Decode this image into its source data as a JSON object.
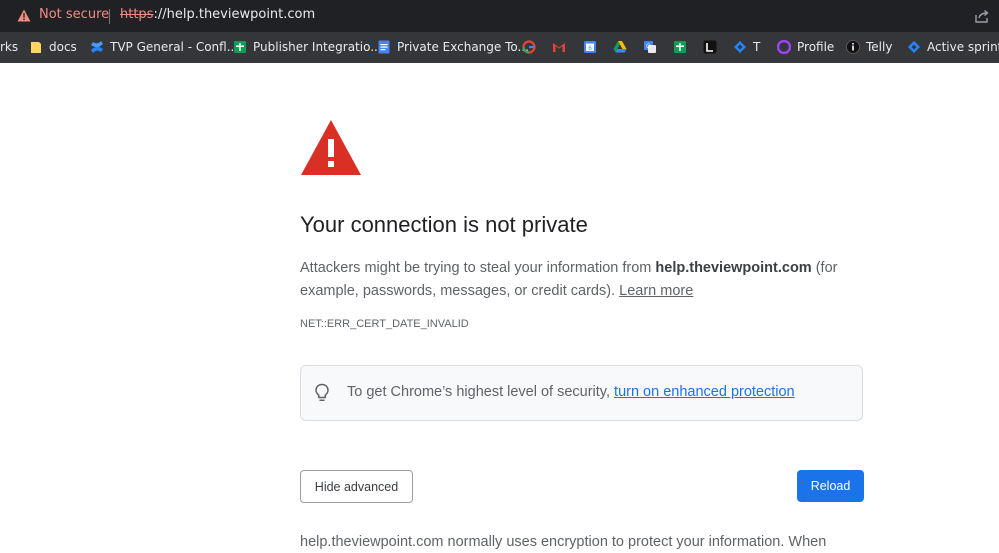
{
  "omnibox": {
    "security_label": "Not secure",
    "url_scheme": "https",
    "url_rest": "://help.theviewpoint.com"
  },
  "bookmarks": [
    {
      "label": "rks",
      "icon": "none"
    },
    {
      "label": "docs",
      "icon": "folder-icon"
    },
    {
      "label": "TVP General - Confl...",
      "icon": "confluence-icon"
    },
    {
      "label": "Publisher Integratio...",
      "icon": "sheets-icon"
    },
    {
      "label": "Private Exchange To...",
      "icon": "docs-icon"
    },
    {
      "label": "",
      "icon": "google-icon"
    },
    {
      "label": "",
      "icon": "gmail-icon"
    },
    {
      "label": "",
      "icon": "calendar-icon"
    },
    {
      "label": "",
      "icon": "drive-icon"
    },
    {
      "label": "",
      "icon": "translate-icon"
    },
    {
      "label": "",
      "icon": "sheets-icon"
    },
    {
      "label": "",
      "icon": "dark-app-icon"
    },
    {
      "label": "T",
      "icon": "jira-icon"
    },
    {
      "label": "Profile",
      "icon": "profile-icon"
    },
    {
      "label": "Telly",
      "icon": "telly-icon"
    },
    {
      "label": "Active sprints",
      "icon": "jira-icon"
    }
  ],
  "page": {
    "heading": "Your connection is not private",
    "para_before": "Attackers might be trying to steal your information from ",
    "para_domain": "help.theviewpoint.com",
    "para_after": " (for example, passwords, messages, or credit cards). ",
    "learn_more": "Learn more",
    "error_code": "NET::ERR_CERT_DATE_INVALID",
    "tip_text": "To get Chrome’s highest level of security, ",
    "tip_link": "turn on enhanced protection",
    "hide_advanced": "Hide advanced",
    "reload": "Reload",
    "bottom_text": "help.theviewpoint.com normally uses encryption to protect your information. When"
  },
  "colors": {
    "warning_red": "#d93025",
    "link_blue": "#1a73e8",
    "not_secure": "#f28b82"
  }
}
